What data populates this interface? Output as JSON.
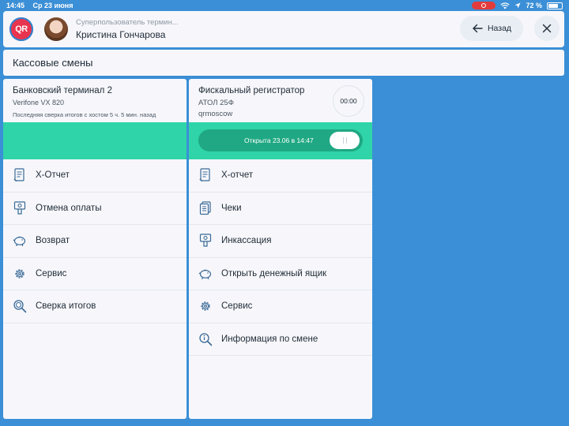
{
  "status_bar": {
    "time": "14:45",
    "date": "Ср 23 июня",
    "battery": "72 %"
  },
  "header": {
    "logo_text": "QR",
    "user_role": "Суперпользователь термин...",
    "user_name": "Кристина Гончарова",
    "back_label": "Назад"
  },
  "section": {
    "title": "Кассовые смены"
  },
  "bank_terminal": {
    "title": "Банковский терминал 2",
    "model": "Verifone VX 820",
    "last_reconcile": "Последняя сверка итогов с хостом 5 ч. 5 мин. назад",
    "menu": [
      {
        "label": "Х-Отчет",
        "icon": "report-icon"
      },
      {
        "label": "Отмена оплаты",
        "icon": "cancel-payment-icon"
      },
      {
        "label": "Возврат",
        "icon": "piggy-bank-icon"
      },
      {
        "label": "Сервис",
        "icon": "gear-icon"
      },
      {
        "label": "Сверка итогов",
        "icon": "search-icon"
      }
    ]
  },
  "fiscal_register": {
    "title": "Фискальный регистратор",
    "model": "АТОЛ 25Ф",
    "account": "qrmoscow",
    "timer": "00:00",
    "shift_status": "Открыта 23.06 в 14:47",
    "menu": [
      {
        "label": "Х-отчет",
        "icon": "report-icon"
      },
      {
        "label": "Чеки",
        "icon": "receipts-icon"
      },
      {
        "label": "Инкассация",
        "icon": "collection-icon"
      },
      {
        "label": "Открыть денежный ящик",
        "icon": "piggy-bank-icon"
      },
      {
        "label": "Сервис",
        "icon": "gear-icon"
      },
      {
        "label": "Информация по смене",
        "icon": "info-icon"
      }
    ]
  },
  "colors": {
    "background": "#3b8fd6",
    "accent_green": "#2fd4a8",
    "pill_green": "#1fa883",
    "logo_red": "#e8344e"
  }
}
